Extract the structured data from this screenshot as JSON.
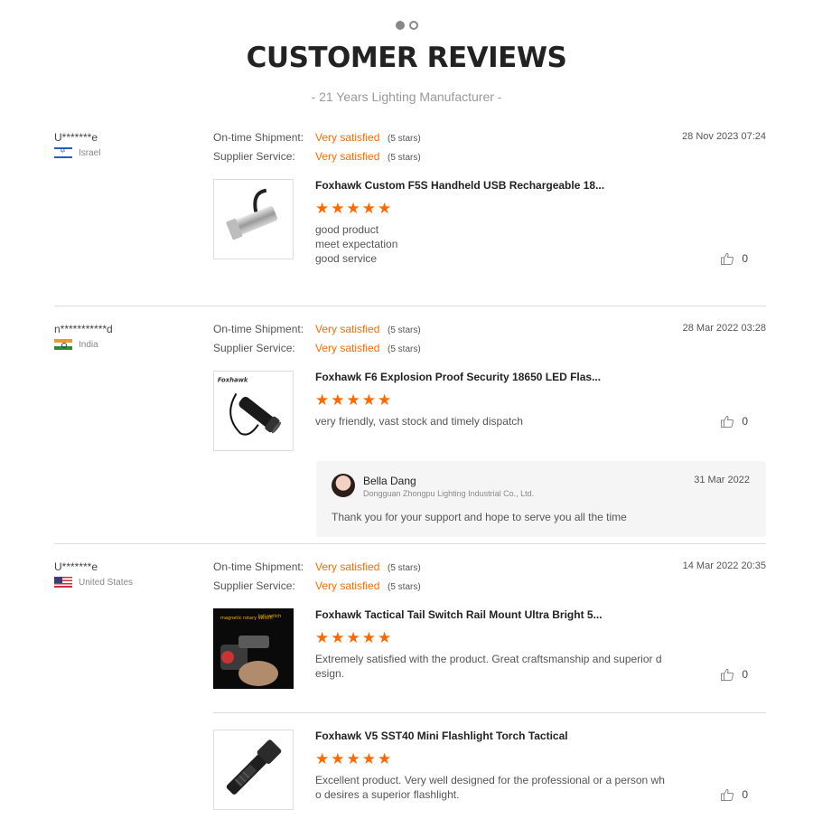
{
  "header": {
    "title": "CUSTOMER REVIEWS",
    "subtitle": "- 21 Years Lighting Manufacturer -"
  },
  "labels": {
    "on_time": "On-time Shipment:",
    "supplier": "Supplier Service:"
  },
  "reviews": [
    {
      "user": "U*******e",
      "country": "Israel",
      "date": "28 Nov 2023 07:24",
      "on_time_value": "Very satisfied",
      "on_time_stars": "(5 stars)",
      "supplier_value": "Very satisfied",
      "supplier_stars": "(5 stars)",
      "items": [
        {
          "product": "Foxhawk Custom F5S Handheld USB Rechargeable 18...",
          "rating": 5,
          "comment": "good product\nmeet expectation\ngood service",
          "likes": "0"
        }
      ]
    },
    {
      "user": "n***********d",
      "country": "India",
      "date": "28 Mar 2022 03:28",
      "on_time_value": "Very satisfied",
      "on_time_stars": "(5 stars)",
      "supplier_value": "Very satisfied",
      "supplier_stars": "(5 stars)",
      "items": [
        {
          "product": "Foxhawk F6 Explosion Proof Security 18650 LED Flas...",
          "rating": 5,
          "comment": "very friendly, vast stock and timely dispatch",
          "likes": "0",
          "image_text": "Foxhawk"
        }
      ],
      "reply": {
        "name": "Bella Dang",
        "company": "Dongguan Zhongpu Lighting Industrial Co., Ltd.",
        "date": "31 Mar 2022",
        "text": "Thank you for your support and hope to serve you all the time"
      }
    },
    {
      "user": "U*******e",
      "country": "United States",
      "date": "14 Mar 2022 20:35",
      "on_time_value": "Very satisfied",
      "on_time_stars": "(5 stars)",
      "supplier_value": "Very satisfied",
      "supplier_stars": "(5 stars)",
      "items": [
        {
          "product": "Foxhawk Tactical Tail Switch Rail Mount Ultra Bright 5...",
          "rating": 5,
          "comment": "Extremely satisfied with the product.  Great craftsmanship and superior d\nesign.",
          "likes": "0",
          "image_labels": [
            "magnetic rotary switch",
            "tail switch"
          ]
        },
        {
          "product": "Foxhawk V5 SST40 Mini Flashlight Torch Tactical",
          "rating": 5,
          "comment": "Excellent product.  Very well designed for the professional or a person wh\no desires a superior flashlight.",
          "likes": "0"
        }
      ]
    }
  ]
}
